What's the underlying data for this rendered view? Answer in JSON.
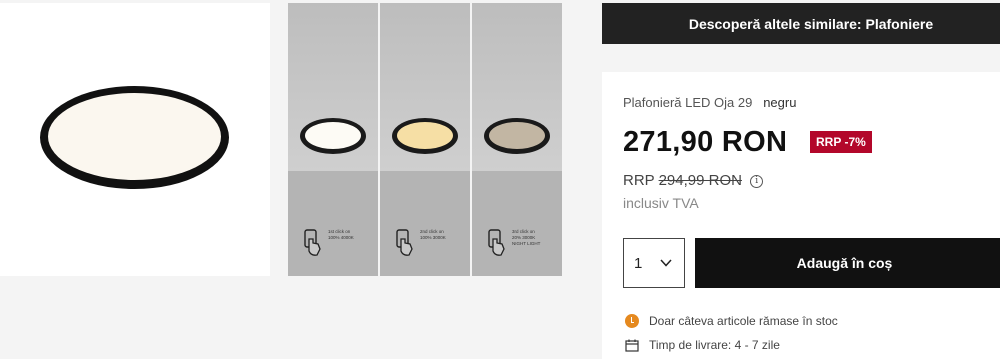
{
  "gallery": {
    "thumbnails": [
      {
        "caption_line1": "1st click on",
        "caption_line2": "100% 4000K",
        "caption_line3": "",
        "light_color": "#fdfbf5",
        "icon": "hand-pointer-icon"
      },
      {
        "caption_line1": "2nd click on",
        "caption_line2": "100% 3000K",
        "caption_line3": "",
        "light_color": "#f6dfa5",
        "icon": "hand-pointer-icon"
      },
      {
        "caption_line1": "3rd click on",
        "caption_line2": "20% 3000K",
        "caption_line3": "NIGHT LIGHT",
        "light_color": "#c2b6a3",
        "icon": "hand-pointer-icon"
      }
    ]
  },
  "similar": {
    "label": "Descoperă altele similare: Plafoniere"
  },
  "product": {
    "name": "Plafonieră LED Oja 29",
    "variant": "negru",
    "price": "271,90 RON",
    "discount_badge": "RRP -7%",
    "rrp_label": "RRP",
    "rrp_price": "294,99 RON",
    "info_icon": "i",
    "vat_note": "inclusiv TVA",
    "quantity": "1",
    "add_to_cart": "Adaugă în coș",
    "stock_text": "Doar câteva articole rămase în stoc",
    "delivery_text": "Timp de livrare: 4 - 7 zile"
  },
  "colors": {
    "accent_badge": "#b3072a",
    "dark": "#111111",
    "stock_icon": "#e5891f"
  }
}
